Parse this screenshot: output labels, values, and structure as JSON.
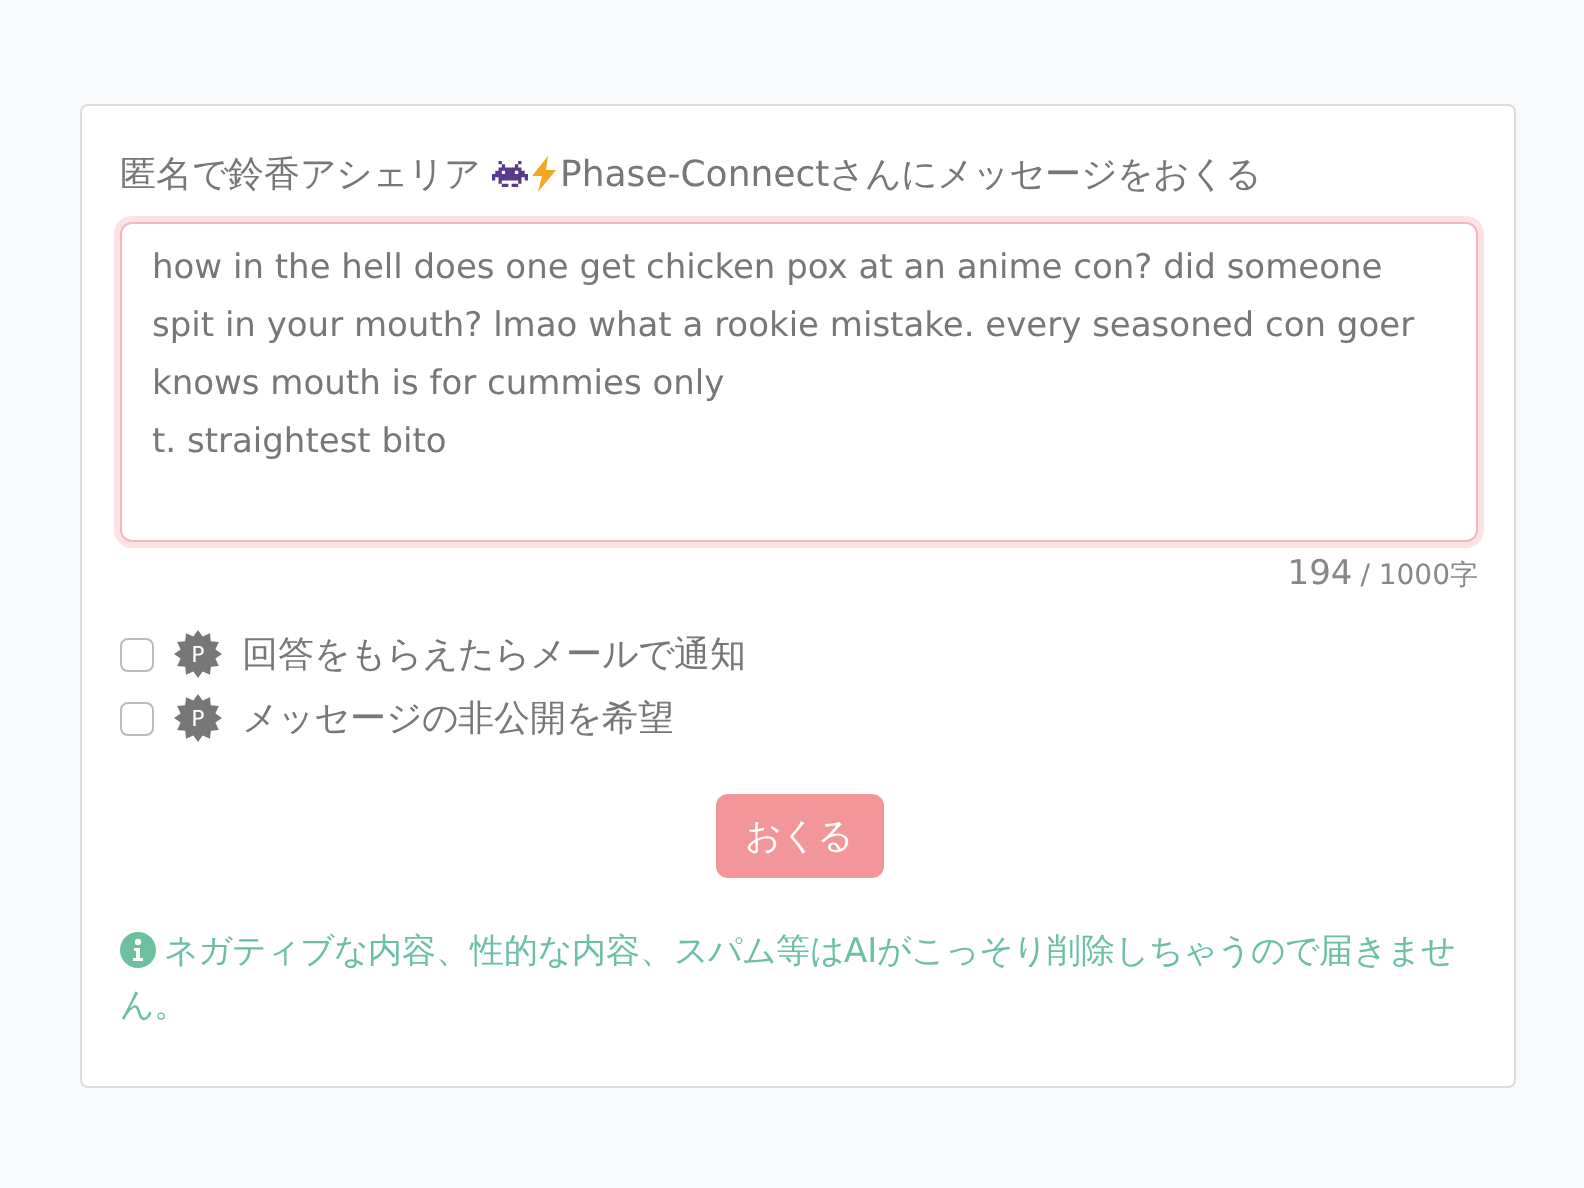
{
  "form": {
    "title_before": "匿名で鈴香アシェリア",
    "title_after": "Phase-Connectさんにメッセージをおくる",
    "message": "how in the hell does one get chicken pox at an anime con? did someone spit in your mouth? lmao what a rookie mistake. every seasoned con goer knows mouth is for cummies only\nt. straightest bito",
    "count": "194",
    "limit": "/ 1000字",
    "options": [
      {
        "badge": "P",
        "label": "回答をもらえたらメールで通知",
        "checked": false
      },
      {
        "badge": "P",
        "label": "メッセージの非公開を希望",
        "checked": false
      }
    ],
    "submit": "おくる",
    "notice": "ネガティブな内容、性的な内容、スパム等はAIがこっそり削除しちゃうので届きません。"
  }
}
